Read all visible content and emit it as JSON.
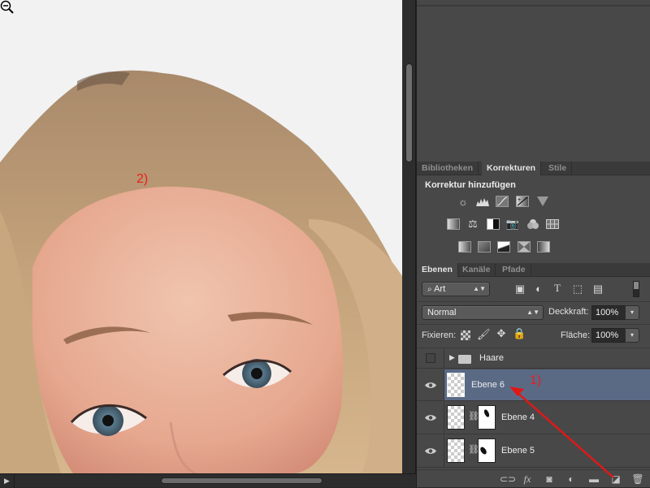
{
  "canvas": {
    "annotation_2": "2)",
    "cursor": "zoom-out-icon"
  },
  "panels": {
    "adjustments": {
      "tabs": [
        {
          "label": "Bibliotheken",
          "active": false
        },
        {
          "label": "Korrekturen",
          "active": true
        },
        {
          "label": "Stile",
          "active": false
        }
      ],
      "title": "Korrektur hinzufügen",
      "rows": [
        [
          "brightness-contrast-icon",
          "levels-icon",
          "curves-icon",
          "exposure-icon",
          "vibrance-icon"
        ],
        [
          "hue-saturation-icon",
          "color-balance-icon",
          "black-white-icon",
          "photo-filter-icon",
          "channel-mixer-icon",
          "color-lookup-icon"
        ],
        [
          "invert-icon",
          "posterize-icon",
          "threshold-icon",
          "selective-color-icon",
          "gradient-map-icon"
        ]
      ]
    },
    "layers": {
      "tabs": [
        {
          "label": "Ebenen",
          "active": true
        },
        {
          "label": "Kanäle",
          "active": false
        },
        {
          "label": "Pfade",
          "active": false
        }
      ],
      "filter_kind": "Art",
      "filter_icons": [
        "pixel-filter-icon",
        "adjustment-filter-icon",
        "type-filter-icon",
        "shape-filter-icon",
        "smart-object-filter-icon"
      ],
      "blend_mode": "Normal",
      "opacity_label": "Deckkraft:",
      "opacity": "100%",
      "lock_label": "Fixieren:",
      "fill_label": "Fläche:",
      "fill": "100%",
      "items": [
        {
          "name": "Haare",
          "type": "group",
          "visible": false,
          "selected": false
        },
        {
          "name": "Ebene 6",
          "type": "layer",
          "visible": true,
          "selected": true
        },
        {
          "name": "Ebene 4",
          "type": "masked",
          "visible": true,
          "selected": false
        },
        {
          "name": "Ebene 5",
          "type": "masked",
          "visible": true,
          "selected": false
        }
      ],
      "annotation_1": "1)",
      "bottom_icons": [
        "link-layers-icon",
        "fx-icon",
        "add-mask-icon",
        "new-adjustment-icon",
        "new-group-icon",
        "new-layer-icon",
        "delete-icon"
      ]
    }
  },
  "colors": {
    "annotation": "#ee1c1c",
    "selected_layer": "#5a6a85",
    "panel_bg": "#484848"
  }
}
